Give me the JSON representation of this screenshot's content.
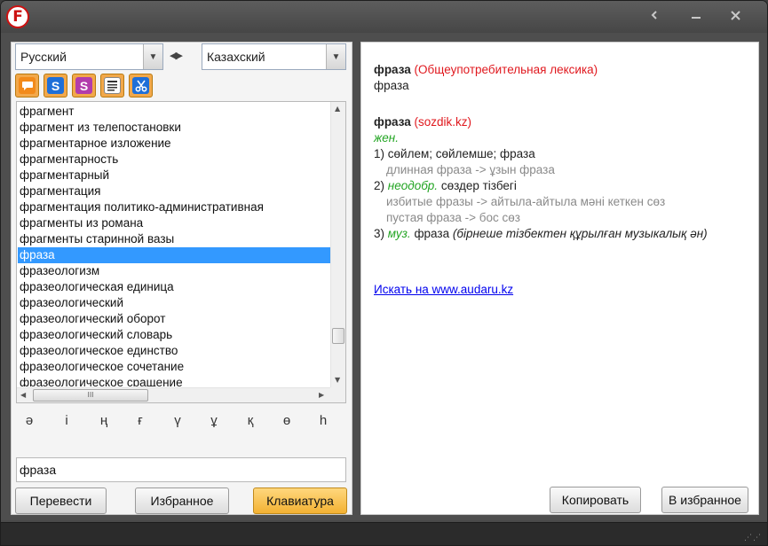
{
  "window": {
    "logo_letter": "F",
    "controls": {
      "back_icon": "chevron-left-icon",
      "min_icon": "minimize-icon",
      "close_icon": "close-icon"
    }
  },
  "languages": {
    "source": "Русский",
    "target": "Казахский",
    "swap_icon": "swap-arrows-icon"
  },
  "toolbar": {
    "buttons": [
      {
        "name": "speech-bubble-icon",
        "glyph": "",
        "color": "#f28a1a"
      },
      {
        "name": "sozdik-blue-icon",
        "glyph": "S",
        "color": "#1e6fd8"
      },
      {
        "name": "sozdik-purple-icon",
        "glyph": "S",
        "color": "#b23cab"
      },
      {
        "name": "text-list-icon",
        "glyph": "",
        "color": "#ffffff"
      },
      {
        "name": "scissors-icon",
        "glyph": "",
        "color": "#1e6fd8"
      }
    ]
  },
  "wordlist": {
    "items": [
      "фрагмент",
      "фрагмент из телепостановки",
      "фрагментарное изложение",
      "фрагментарность",
      "фрагментарный",
      "фрагментация",
      "фрагментация политико-административная",
      "фрагменты из романа",
      "фрагменты старинной вазы",
      "фраза",
      "фразеологизм",
      "фразеологическая единица",
      "фразеологический",
      "фразеологический оборот",
      "фразеологический словарь",
      "фразеологическое единство",
      "фразеологическое сочетание",
      "фразеологическое сращение"
    ],
    "selected": "фраза",
    "hscroll_thumb_label": "III"
  },
  "keyboard": {
    "keys": [
      "ә",
      "і",
      "ң",
      "ғ",
      "ү",
      "ұ",
      "қ",
      "ө",
      "һ"
    ]
  },
  "search": {
    "value": "фраза"
  },
  "left_buttons": {
    "translate": "Перевести",
    "favorites": "Избранное",
    "keyboard": "Клавиатура"
  },
  "article": {
    "entry1": {
      "headword": "фраза",
      "source": "(Общеупотребительная лексика)",
      "translation": "фраза"
    },
    "entry2": {
      "headword": "фраза",
      "source": "(sozdik.kz)",
      "pos": "жен.",
      "sense1_num": "1)",
      "sense1": "сөйлем; сөйлемше; фраза",
      "sense1_ex": "длинная фраза -> ұзын фраза",
      "sense2_num": "2)",
      "sense2_label": "неодобр.",
      "sense2": "сөздер тізбегі",
      "sense2_ex1": "избитые фразы -> айтыла-айтыла мәні кеткен сөз",
      "sense2_ex2": "пустая фраза -> бос сөз",
      "sense3_num": "3)",
      "sense3_label": "муз.",
      "sense3": "фраза",
      "sense3_note": "(бірнеше тізбектен құрылған музыкалық ән)"
    },
    "link": "Искать на www.audaru.kz"
  },
  "right_buttons": {
    "copy": "Копировать",
    "add_favorite": "В избранное"
  }
}
